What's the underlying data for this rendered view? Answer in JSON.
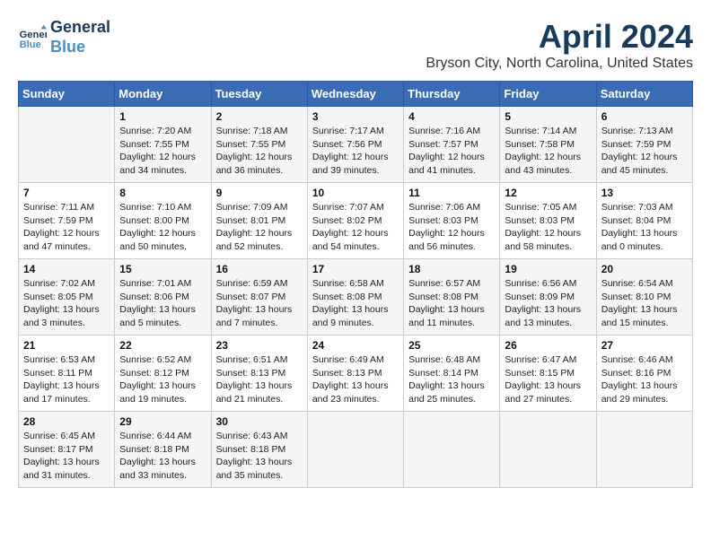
{
  "header": {
    "logo_line1": "General",
    "logo_line2": "Blue",
    "title": "April 2024",
    "location": "Bryson City, North Carolina, United States"
  },
  "days_of_week": [
    "Sunday",
    "Monday",
    "Tuesday",
    "Wednesday",
    "Thursday",
    "Friday",
    "Saturday"
  ],
  "weeks": [
    [
      {
        "day": "",
        "info": ""
      },
      {
        "day": "1",
        "info": "Sunrise: 7:20 AM\nSunset: 7:55 PM\nDaylight: 12 hours\nand 34 minutes."
      },
      {
        "day": "2",
        "info": "Sunrise: 7:18 AM\nSunset: 7:55 PM\nDaylight: 12 hours\nand 36 minutes."
      },
      {
        "day": "3",
        "info": "Sunrise: 7:17 AM\nSunset: 7:56 PM\nDaylight: 12 hours\nand 39 minutes."
      },
      {
        "day": "4",
        "info": "Sunrise: 7:16 AM\nSunset: 7:57 PM\nDaylight: 12 hours\nand 41 minutes."
      },
      {
        "day": "5",
        "info": "Sunrise: 7:14 AM\nSunset: 7:58 PM\nDaylight: 12 hours\nand 43 minutes."
      },
      {
        "day": "6",
        "info": "Sunrise: 7:13 AM\nSunset: 7:59 PM\nDaylight: 12 hours\nand 45 minutes."
      }
    ],
    [
      {
        "day": "7",
        "info": "Sunrise: 7:11 AM\nSunset: 7:59 PM\nDaylight: 12 hours\nand 47 minutes."
      },
      {
        "day": "8",
        "info": "Sunrise: 7:10 AM\nSunset: 8:00 PM\nDaylight: 12 hours\nand 50 minutes."
      },
      {
        "day": "9",
        "info": "Sunrise: 7:09 AM\nSunset: 8:01 PM\nDaylight: 12 hours\nand 52 minutes."
      },
      {
        "day": "10",
        "info": "Sunrise: 7:07 AM\nSunset: 8:02 PM\nDaylight: 12 hours\nand 54 minutes."
      },
      {
        "day": "11",
        "info": "Sunrise: 7:06 AM\nSunset: 8:03 PM\nDaylight: 12 hours\nand 56 minutes."
      },
      {
        "day": "12",
        "info": "Sunrise: 7:05 AM\nSunset: 8:03 PM\nDaylight: 12 hours\nand 58 minutes."
      },
      {
        "day": "13",
        "info": "Sunrise: 7:03 AM\nSunset: 8:04 PM\nDaylight: 13 hours\nand 0 minutes."
      }
    ],
    [
      {
        "day": "14",
        "info": "Sunrise: 7:02 AM\nSunset: 8:05 PM\nDaylight: 13 hours\nand 3 minutes."
      },
      {
        "day": "15",
        "info": "Sunrise: 7:01 AM\nSunset: 8:06 PM\nDaylight: 13 hours\nand 5 minutes."
      },
      {
        "day": "16",
        "info": "Sunrise: 6:59 AM\nSunset: 8:07 PM\nDaylight: 13 hours\nand 7 minutes."
      },
      {
        "day": "17",
        "info": "Sunrise: 6:58 AM\nSunset: 8:08 PM\nDaylight: 13 hours\nand 9 minutes."
      },
      {
        "day": "18",
        "info": "Sunrise: 6:57 AM\nSunset: 8:08 PM\nDaylight: 13 hours\nand 11 minutes."
      },
      {
        "day": "19",
        "info": "Sunrise: 6:56 AM\nSunset: 8:09 PM\nDaylight: 13 hours\nand 13 minutes."
      },
      {
        "day": "20",
        "info": "Sunrise: 6:54 AM\nSunset: 8:10 PM\nDaylight: 13 hours\nand 15 minutes."
      }
    ],
    [
      {
        "day": "21",
        "info": "Sunrise: 6:53 AM\nSunset: 8:11 PM\nDaylight: 13 hours\nand 17 minutes."
      },
      {
        "day": "22",
        "info": "Sunrise: 6:52 AM\nSunset: 8:12 PM\nDaylight: 13 hours\nand 19 minutes."
      },
      {
        "day": "23",
        "info": "Sunrise: 6:51 AM\nSunset: 8:13 PM\nDaylight: 13 hours\nand 21 minutes."
      },
      {
        "day": "24",
        "info": "Sunrise: 6:49 AM\nSunset: 8:13 PM\nDaylight: 13 hours\nand 23 minutes."
      },
      {
        "day": "25",
        "info": "Sunrise: 6:48 AM\nSunset: 8:14 PM\nDaylight: 13 hours\nand 25 minutes."
      },
      {
        "day": "26",
        "info": "Sunrise: 6:47 AM\nSunset: 8:15 PM\nDaylight: 13 hours\nand 27 minutes."
      },
      {
        "day": "27",
        "info": "Sunrise: 6:46 AM\nSunset: 8:16 PM\nDaylight: 13 hours\nand 29 minutes."
      }
    ],
    [
      {
        "day": "28",
        "info": "Sunrise: 6:45 AM\nSunset: 8:17 PM\nDaylight: 13 hours\nand 31 minutes."
      },
      {
        "day": "29",
        "info": "Sunrise: 6:44 AM\nSunset: 8:18 PM\nDaylight: 13 hours\nand 33 minutes."
      },
      {
        "day": "30",
        "info": "Sunrise: 6:43 AM\nSunset: 8:18 PM\nDaylight: 13 hours\nand 35 minutes."
      },
      {
        "day": "",
        "info": ""
      },
      {
        "day": "",
        "info": ""
      },
      {
        "day": "",
        "info": ""
      },
      {
        "day": "",
        "info": ""
      }
    ]
  ]
}
